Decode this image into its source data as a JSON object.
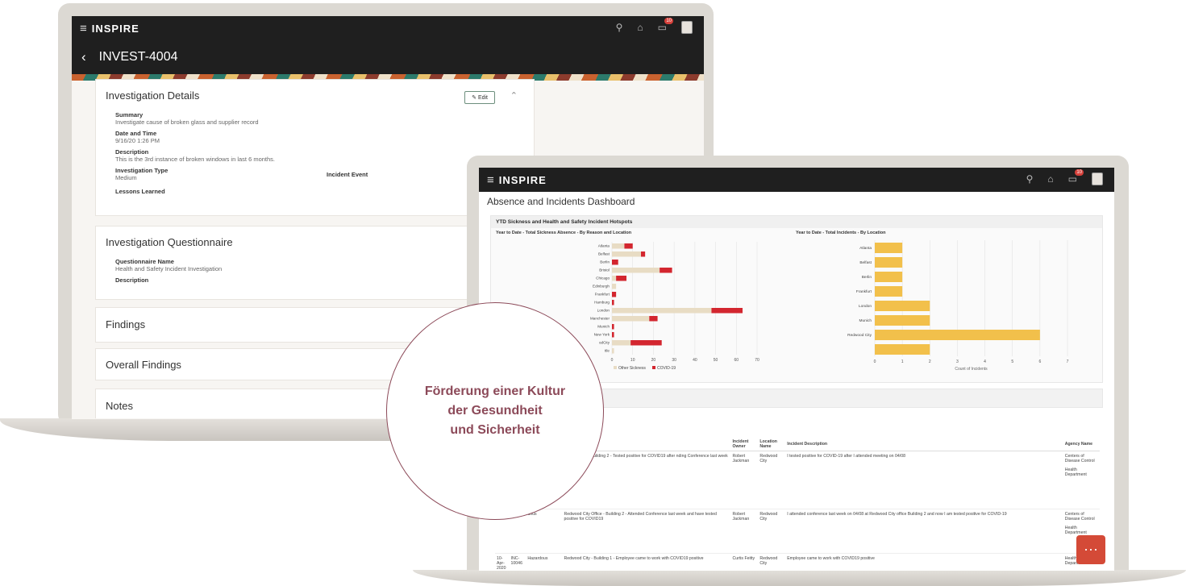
{
  "colors": {
    "accent": "#8c4a59",
    "covid": "#d3262f",
    "other_sickness": "#e8dcc4",
    "incident_bar": "#f2c04b",
    "chat": "#d44a37"
  },
  "back_app": {
    "brand": "INSPIRE",
    "record_title": "INVEST-4004",
    "badge": "10",
    "details": {
      "title": "Investigation Details",
      "edit_label": "Edit",
      "summary_label": "Summary",
      "summary_value": "Investigate cause of broken glass and supplier record",
      "datetime_label": "Date and Time",
      "datetime_value": "9/16/20 1:26 PM",
      "description_label": "Description",
      "description_value": "This is the 3rd instance of broken windows in last 6 months.",
      "type_label": "Investigation Type",
      "type_value": "Medium",
      "incident_event_label": "Incident Event",
      "lessons_label": "Lessons Learned"
    },
    "questionnaire": {
      "title": "Investigation Questionnaire",
      "name_label": "Questionnaire Name",
      "name_value": "Health and Safety Incident Investigation",
      "description_label": "Description"
    },
    "findings_title": "Findings",
    "overall_findings_title": "Overall Findings",
    "notes_title": "Notes"
  },
  "front_app": {
    "brand": "INSPIRE",
    "badge": "10",
    "dashboard_title": "Absence and Incidents Dashboard",
    "section_title": "YTD Sickness and Health and Safety Incident Hotspots",
    "table_headers": [
      "Incident Owner",
      "Location Name",
      "Incident Description",
      "Agency Name"
    ],
    "summary_header_fragment": "ary",
    "rows": [
      {
        "summary": "edwood City - Building 2 - Tested positive for COVID19 after nding Conference last week",
        "owner": "Robert Jackman",
        "location": "Redwood City",
        "description": "I tested positive for COVID-19 after I attended meeting on 04/08",
        "agencies": [
          "Centers of Disease Control",
          "Health Department"
        ]
      },
      {
        "type": "dous",
        "summary": "Redwood City Office - Building 2 - Attended Conference last week and have tested positive for COVID19",
        "owner": "Robert Jackman",
        "location": "Redwood City",
        "description": "I attended conference last week on 04/08 at Redwood City office Building 2 and now I am tested positive for COVID-19",
        "agencies": [
          "Centers of Disease Control",
          "Health Department"
        ]
      },
      {
        "date": "10-Apr-2020",
        "id": "INC-10046",
        "type": "Hazardous",
        "summary": "Redwood City - Building 1 - Employee came to work with COVID19 positive",
        "owner": "Curtis Feitty",
        "location": "Redwood City",
        "description": "Employee came to work with COVID19 positive",
        "agencies": [
          "Health Department"
        ]
      }
    ]
  },
  "overlay": {
    "line1": "Förderung einer Kultur",
    "line2": "der Gesundheit",
    "line3": "und Sicherheit"
  },
  "chart_data": [
    {
      "type": "bar",
      "orientation": "horizontal",
      "stacked": true,
      "title": "Year to Date - Total Sickness Absence - By Reason and Location",
      "categories": [
        "Atlanta",
        "Belfast",
        "Berlin",
        "Bristol",
        "Chicago",
        "Edinburgh",
        "Frankfurt",
        "Hamburg",
        "London",
        "Manchester",
        "Munich",
        "New York",
        "Redwood City",
        "Seattle"
      ],
      "category_labels": [
        "Atlanta",
        "Belfast",
        "Berlin",
        "Bristol",
        "Chicago",
        "Edinburgh",
        "Frankfurt",
        "Hamburg",
        "London",
        "Manchester",
        "Munich",
        "New York",
        "odCity",
        "ttle"
      ],
      "series": [
        {
          "name": "Other Sickness",
          "values": [
            6,
            14,
            0,
            23,
            2,
            2,
            0,
            0,
            48,
            18,
            0,
            0,
            9,
            1
          ]
        },
        {
          "name": "COVID-19",
          "values": [
            4,
            2,
            3,
            6,
            5,
            0,
            2,
            1,
            15,
            4,
            1,
            1,
            15,
            0
          ]
        }
      ],
      "xlim": [
        0,
        70
      ],
      "xticks": [
        0,
        10,
        20,
        30,
        40,
        50,
        60,
        70
      ]
    },
    {
      "type": "bar",
      "orientation": "horizontal",
      "title": "Year to Date - Total Incidents - By Location",
      "categories": [
        "Atlanta",
        "Belfast",
        "Berlin",
        "Frankfurt",
        "London",
        "Munich",
        "Redwood City",
        "Seattle"
      ],
      "category_labels": [
        "Atlanta",
        "Belfast",
        "Berlin",
        "Frankfurt",
        "London",
        "Munich",
        "Redwood City",
        ""
      ],
      "values": [
        1,
        1,
        1,
        1,
        2,
        2,
        6,
        2
      ],
      "xlabel": "Count of Incidents",
      "xlim": [
        0,
        7
      ],
      "xticks": [
        0,
        1,
        2,
        3,
        4,
        5,
        6,
        7
      ]
    }
  ]
}
